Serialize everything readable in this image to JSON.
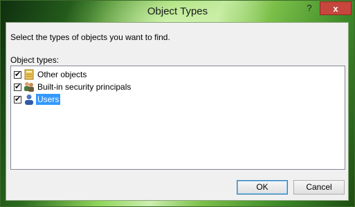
{
  "window": {
    "title": "Object Types",
    "help_glyph": "?",
    "close_glyph": "x"
  },
  "dialog": {
    "instruction": "Select the types of objects you want to find.",
    "list_label": "Object types:",
    "items": [
      {
        "label": "Other objects",
        "checked": true,
        "icon": "folder-icon",
        "selected": false
      },
      {
        "label": "Built-in security principals",
        "checked": true,
        "icon": "group-icon",
        "selected": false
      },
      {
        "label": "Users",
        "checked": true,
        "icon": "user-icon",
        "selected": true
      }
    ],
    "check_glyph": "✔"
  },
  "buttons": {
    "ok": "OK",
    "cancel": "Cancel"
  },
  "colors": {
    "selection": "#3399ff",
    "close_button": "#c7463d"
  }
}
